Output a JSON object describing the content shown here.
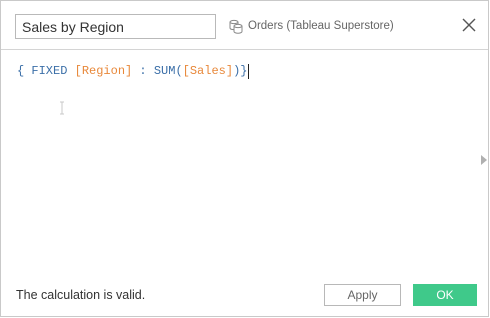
{
  "dialog": {
    "calc_name": "Sales by Region",
    "datasource": {
      "icon": "linked-datasource-icon",
      "label": "Orders (Tableau Superstore)"
    },
    "close_icon": "close-icon"
  },
  "editor": {
    "tokens": {
      "open_brace": "{ ",
      "keyword_fixed": "FIXED",
      "field_region": "[Region]",
      "colon": " : ",
      "func_sum": "SUM(",
      "field_sales": "[Sales]",
      "close": ")}"
    },
    "expand_icon": "triangle-right-icon"
  },
  "footer": {
    "status": "The calculation is valid.",
    "apply_label": "Apply",
    "ok_label": "OK"
  },
  "colors": {
    "keyword": "#3b6fa8",
    "field": "#e8883a",
    "ok_button": "#3fc98a"
  }
}
